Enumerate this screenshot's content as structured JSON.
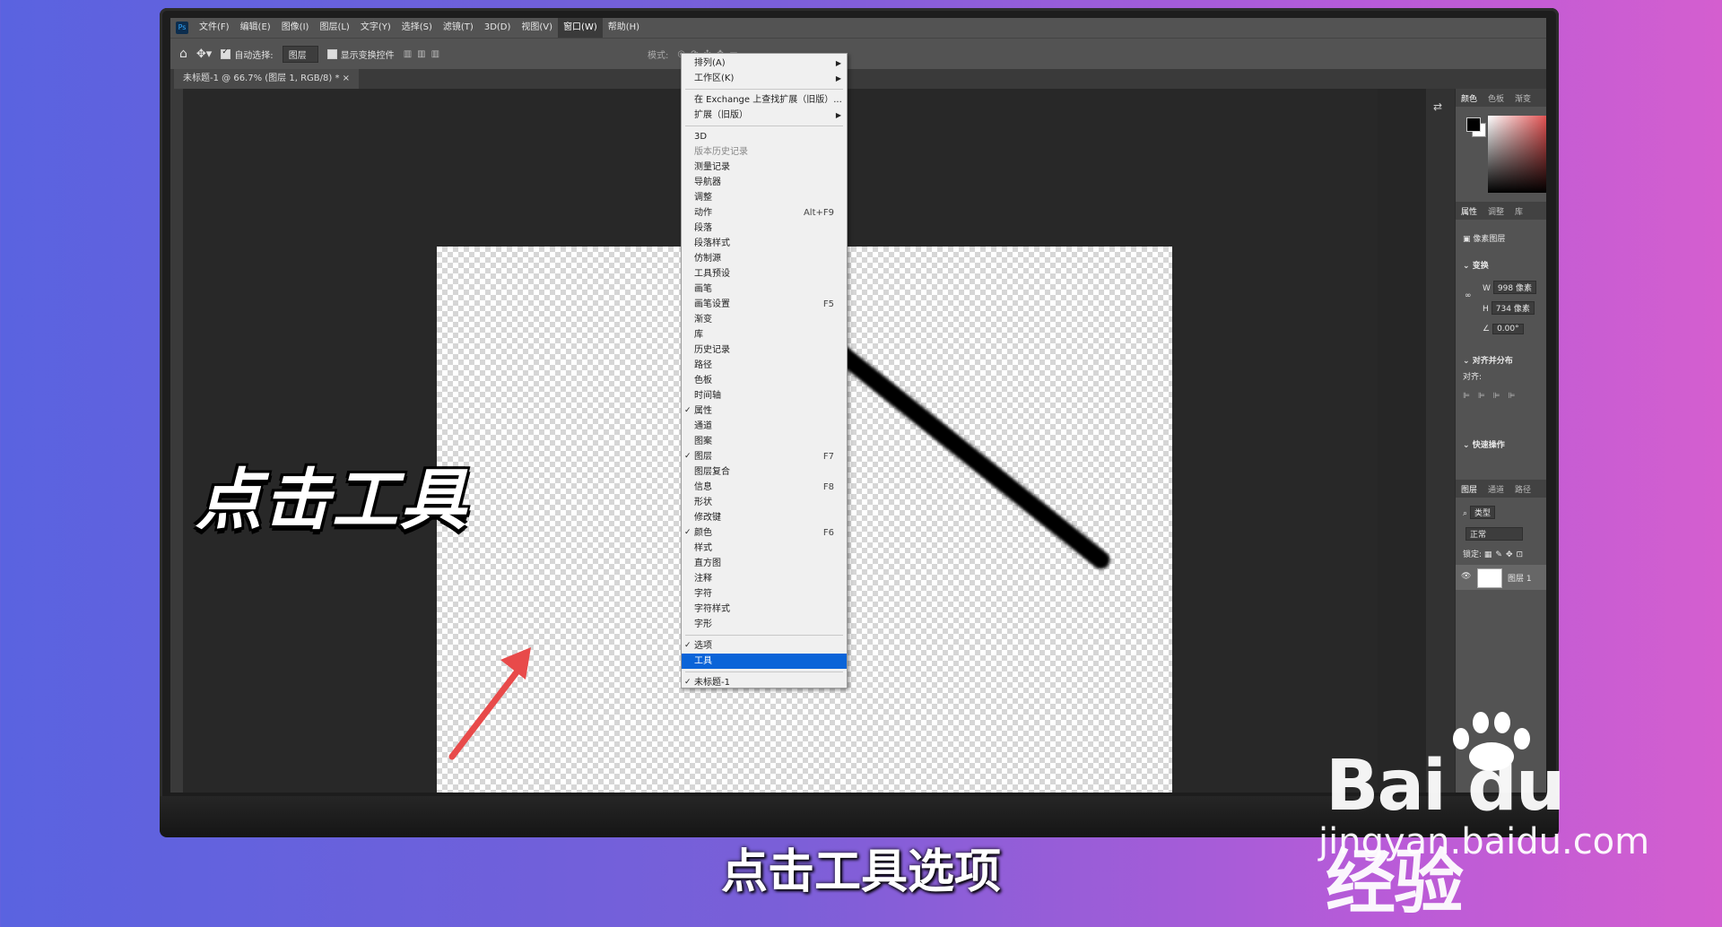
{
  "app": {
    "logo": "Ps"
  },
  "menubar": [
    "文件(F)",
    "编辑(E)",
    "图像(I)",
    "图层(L)",
    "文字(Y)",
    "选择(S)",
    "滤镜(T)",
    "3D(D)",
    "视图(V)",
    "窗口(W)",
    "帮助(H)"
  ],
  "options_bar": {
    "auto_select_label": "自动选择:",
    "auto_select_value": "图层",
    "show_transform_label": "显示变换控件",
    "mode_label": "模式:"
  },
  "document_tab": "未标题-1 @ 66.7% (图层 1, RGB/8) *",
  "window_menu": {
    "items": [
      {
        "label": "排列(A)",
        "submenu": true
      },
      {
        "label": "工作区(K)",
        "submenu": true
      },
      {
        "sep": true
      },
      {
        "label": "在 Exchange 上查找扩展（旧版）..."
      },
      {
        "label": "扩展（旧版）",
        "submenu": true
      },
      {
        "sep": true
      },
      {
        "label": "3D"
      },
      {
        "label": "版本历史记录",
        "dim": true
      },
      {
        "label": "测量记录"
      },
      {
        "label": "导航器"
      },
      {
        "label": "调整"
      },
      {
        "label": "动作",
        "key": "Alt+F9"
      },
      {
        "label": "段落"
      },
      {
        "label": "段落样式"
      },
      {
        "label": "仿制源"
      },
      {
        "label": "工具预设"
      },
      {
        "label": "画笔"
      },
      {
        "label": "画笔设置",
        "key": "F5"
      },
      {
        "label": "渐变"
      },
      {
        "label": "库"
      },
      {
        "label": "历史记录"
      },
      {
        "label": "路径"
      },
      {
        "label": "色板"
      },
      {
        "label": "时间轴"
      },
      {
        "label": "属性",
        "checked": true
      },
      {
        "label": "通道"
      },
      {
        "label": "图案"
      },
      {
        "label": "图层",
        "checked": true,
        "key": "F7"
      },
      {
        "label": "图层复合"
      },
      {
        "label": "信息",
        "key": "F8"
      },
      {
        "label": "形状"
      },
      {
        "label": "修改键"
      },
      {
        "label": "颜色",
        "checked": true,
        "key": "F6"
      },
      {
        "label": "样式"
      },
      {
        "label": "直方图"
      },
      {
        "label": "注释"
      },
      {
        "label": "字符"
      },
      {
        "label": "字符样式"
      },
      {
        "label": "字形"
      },
      {
        "sep": true
      },
      {
        "label": "选项",
        "checked": true
      },
      {
        "label": "工具",
        "highlight": true
      },
      {
        "sep": true
      },
      {
        "label": "未标题-1",
        "checked": true
      }
    ]
  },
  "panels": {
    "color_tabs": [
      "颜色",
      "色板",
      "渐变"
    ],
    "props_tabs": [
      "属性",
      "调整",
      "库"
    ],
    "pixel_layer": "像素图层",
    "transform": "变换",
    "w_label": "W",
    "w_value": "998 像素",
    "h_label": "H",
    "h_value": "734 像素",
    "angle_value": "0.00°",
    "align_title": "对齐并分布",
    "align_label": "对齐:",
    "quick_actions": "快速操作",
    "layers_tabs": [
      "图层",
      "通道",
      "路径"
    ],
    "kind_filter": "类型",
    "blend_mode": "正常",
    "lock_label": "锁定:",
    "layer_name": "图层 1"
  },
  "overlay": {
    "big_caption": "点击工具",
    "subtitle": "点击工具选项",
    "watermark_brand": "Bai du 经验",
    "watermark_url": "jingyan.baidu.com"
  },
  "colors": {
    "accent": "#0a64d8",
    "arrow": "#e84a4a"
  }
}
